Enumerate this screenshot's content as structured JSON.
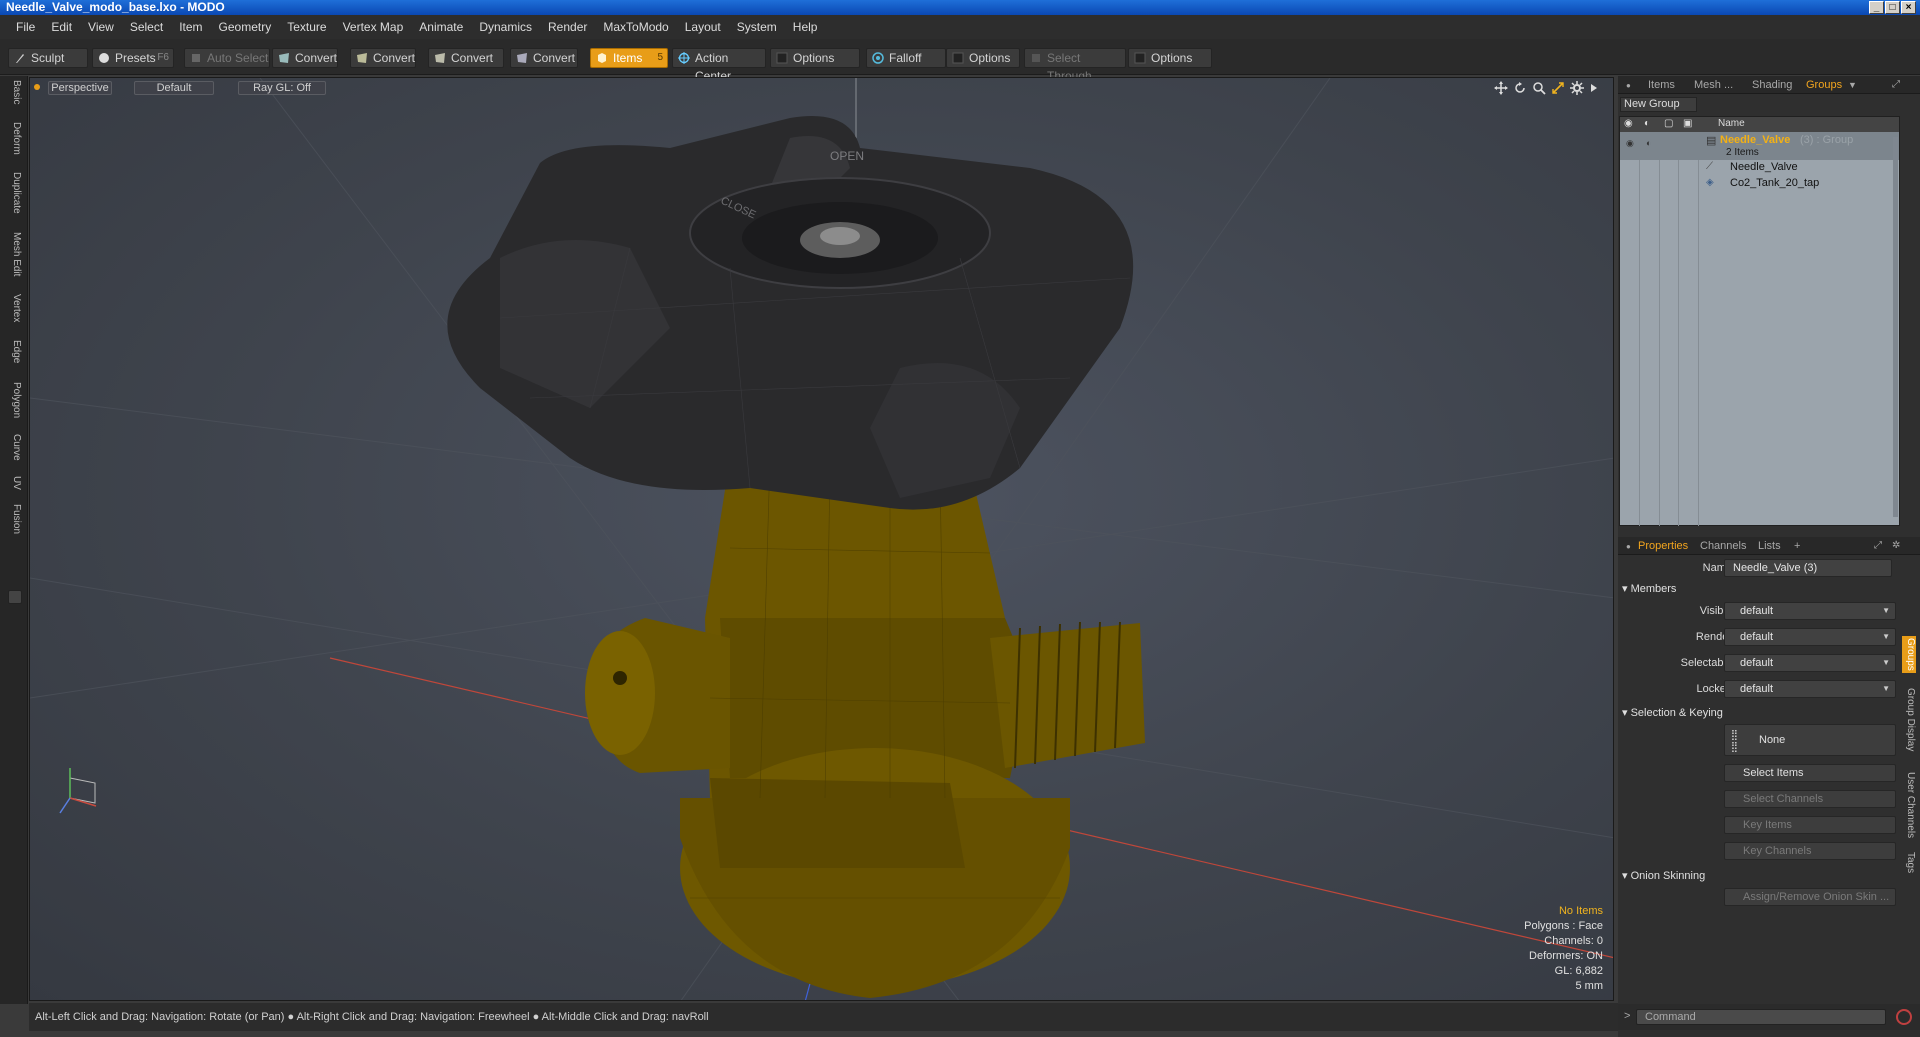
{
  "window": {
    "title": "Needle_Valve_modo_base.lxo - MODO"
  },
  "menu": [
    "File",
    "Edit",
    "View",
    "Select",
    "Item",
    "Geometry",
    "Texture",
    "Vertex Map",
    "Animate",
    "Dynamics",
    "Render",
    "MaxToModo",
    "Layout",
    "System",
    "Help"
  ],
  "toolbar": {
    "sculpt": "Sculpt",
    "presets": "Presets",
    "presets_key": "F6",
    "auto_select": "Auto Select",
    "convert1": "Convert",
    "convert2": "Convert",
    "convert3": "Convert",
    "convert4": "Convert",
    "items": "Items",
    "items_key": "5",
    "action_center": "Action Center",
    "options1": "Options",
    "falloff": "Falloff",
    "options2": "Options",
    "select_through": "Select Through",
    "options3": "Options"
  },
  "left_tabs": [
    "Basic",
    "Deform",
    "Duplicate",
    "Mesh Edit",
    "Vertex",
    "Edge",
    "Polygon",
    "Curve",
    "UV",
    "Fusion"
  ],
  "viewport": {
    "view": "Perspective",
    "style": "Default",
    "raygl": "Ray GL: Off",
    "stats": {
      "selection": "No Items",
      "polygons": "Polygons : Face",
      "channels": "Channels: 0",
      "deformers": "Deformers: ON",
      "gl": "GL: 6,882",
      "scale": "5 mm"
    },
    "knob_text": {
      "open": "OPEN",
      "close": "CLOSE"
    }
  },
  "status": "Alt-Left Click and Drag: Navigation: Rotate (or Pan) ● Alt-Right Click and Drag: Navigation: Freewheel ● Alt-Middle Click and Drag: navRoll",
  "groups_panel": {
    "tabs": [
      "Items",
      "Mesh ...",
      "Shading",
      "Groups"
    ],
    "new_group": "New Group",
    "col_name": "Name",
    "group_name": "Needle_Valve",
    "group_suffix": "(3) : Group",
    "group_count": "2 Items",
    "children": [
      "Needle_Valve",
      "Co2_Tank_20_tap"
    ]
  },
  "properties_panel": {
    "tabs": [
      "Properties",
      "Channels",
      "Lists",
      "+"
    ],
    "name_label": "Name",
    "name_value": "Needle_Valve (3)",
    "members": "Members",
    "visible_label": "Visible",
    "visible_value": "default",
    "render_label": "Render",
    "render_value": "default",
    "selectable_label": "Selectable",
    "selectable_value": "default",
    "locked_label": "Locked",
    "locked_value": "default",
    "selection_keying": "Selection & Keying",
    "none_btn": "None",
    "select_items": "Select Items",
    "select_channels": "Select Channels",
    "key_items": "Key Items",
    "key_channels": "Key Channels",
    "onion_skinning": "Onion Skinning",
    "assign_onion": "Assign/Remove Onion Skin ...",
    "side_tabs": [
      "Groups",
      "Group Display",
      "User Channels",
      "Tags"
    ]
  },
  "command": {
    "placeholder": "Command"
  },
  "colors": {
    "accent": "#e89d18",
    "selected_text": "#f1b41e",
    "brass": "#7a6100",
    "knob": "#2b2b2b"
  }
}
